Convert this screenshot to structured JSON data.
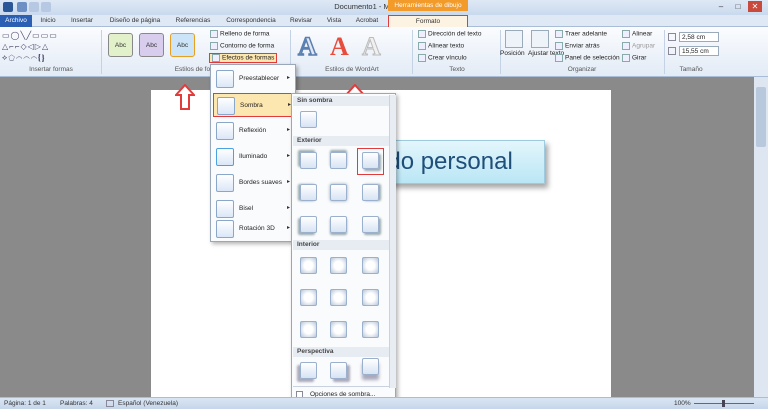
{
  "window": {
    "title": "Documento1 - Microsoft Word",
    "contextual_header": "Herramientas de dibujo",
    "controls": [
      "–",
      "□",
      "✕"
    ]
  },
  "tabs": [
    "Archivo",
    "Inicio",
    "Insertar",
    "Diseño de página",
    "Referencias",
    "Correspondencia",
    "Revisar",
    "Vista",
    "Acrobat",
    "Formato"
  ],
  "ribbon": {
    "insert_shapes_label": "Insertar formas",
    "shape_styles_label": "Estilos de forma",
    "style_buttons": [
      "Abc",
      "Abc",
      "Abc"
    ],
    "shape_commands": [
      "Relleno de forma",
      "Contorno de forma",
      "Efectos de formas"
    ],
    "wordart_label": "Estilos de WordArt",
    "wordart_letters": [
      "A",
      "A",
      "A"
    ],
    "text_group_label": "Texto",
    "text_commands": [
      "Dirección del texto",
      "Alinear texto",
      "Crear vínculo"
    ],
    "arrange_label": "Organizar",
    "arrange_buttons": [
      "Posición",
      "Ajustar texto"
    ],
    "arrange_commands": [
      "Traer adelante",
      "Enviar atrás",
      "Panel de selección",
      "Alinear",
      "Agrupar",
      "Girar"
    ],
    "size_label": "Tamaño",
    "height_value": "2,58 cm",
    "width_value": "15,55 cm"
  },
  "effects_menu": {
    "items": [
      {
        "label": "Preestablecer"
      },
      {
        "label": "Sombra"
      },
      {
        "label": "Reflexión"
      },
      {
        "label": "Iluminado"
      },
      {
        "label": "Bordes suaves"
      },
      {
        "label": "Bisel"
      },
      {
        "label": "Rotación 3D"
      }
    ]
  },
  "shadow_panel": {
    "sections": [
      "Sin sombra",
      "Exterior",
      "Interior",
      "Perspectiva"
    ],
    "options_link": "Opciones de sombra..."
  },
  "document": {
    "textbox_text": "ado personal"
  },
  "statusbar": {
    "page": "Página: 1 de 1",
    "words": "Palabras: 4",
    "language": "Español (Venezuela)",
    "zoom": "100%"
  }
}
